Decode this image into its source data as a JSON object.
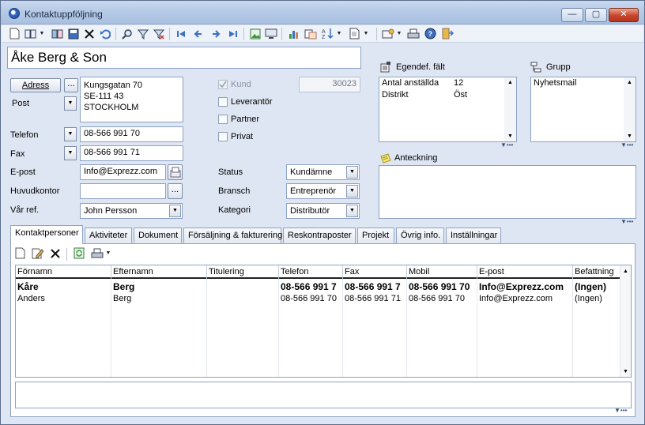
{
  "window": {
    "title": "Kontaktuppföljning",
    "controls": {
      "minimize": "—",
      "maximize": "▢",
      "close": "✕"
    }
  },
  "toolbar": {
    "icons": [
      "new-icon",
      "open-book-icon",
      "books-icon",
      "save-icon",
      "delete-icon",
      "undo-icon",
      "search-icon",
      "filter-icon",
      "clear-filter-icon",
      "first-record-icon",
      "previous-record-icon",
      "next-record-icon",
      "last-record-icon",
      "picture-icon",
      "monitor-icon",
      "chart-icon",
      "report-icon",
      "sort-icon",
      "document-icon",
      "settings-icon",
      "print-icon",
      "help-icon",
      "exit-icon"
    ]
  },
  "company": {
    "name": "Åke Berg & Son"
  },
  "address": {
    "button_label": "Adress",
    "more_label": "...",
    "type_label": "Post",
    "lines": "Kungsgatan 70\nSE-111 43 STOCKHOLM"
  },
  "contact_fields": {
    "phone_label": "Telefon",
    "phone_value": "08-566 991 70",
    "fax_label": "Fax",
    "fax_value": "08-566 991 71",
    "email_label": "E-post",
    "email_value": "Info@Exprezz.com",
    "head_office_label": "Huvudkontor",
    "head_office_value": "",
    "head_office_more": "...",
    "our_ref_label": "Vår ref.",
    "our_ref_value": "John Persson"
  },
  "flags": {
    "kund_label": "Kund",
    "kund_checked": true,
    "kund_number": "30023",
    "leverantor_label": "Leverantör",
    "partner_label": "Partner",
    "privat_label": "Privat"
  },
  "classification": {
    "status_label": "Status",
    "status_value": "Kundämne",
    "bransch_label": "Bransch",
    "bransch_value": "Entreprenör",
    "kategori_label": "Kategori",
    "kategori_value": "Distributör"
  },
  "custom_fields": {
    "title": "Egendef. fält",
    "rows": [
      {
        "name": "Antal anställda",
        "value": "12"
      },
      {
        "name": "Distrikt",
        "value": "Öst"
      }
    ]
  },
  "group": {
    "title": "Grupp",
    "items": [
      "Nyhetsmail"
    ]
  },
  "note": {
    "title": "Anteckning",
    "text": ""
  },
  "tabs": [
    "Kontaktpersoner",
    "Aktiviteter",
    "Dokument",
    "Försäljning & fakturering",
    "Reskontraposter",
    "Projekt",
    "Övrig info.",
    "Inställningar"
  ],
  "contacts": {
    "columns": [
      "Förnamn",
      "Efternamn",
      "Titulering",
      "Telefon",
      "Fax",
      "Mobil",
      "E-post",
      "Befattning"
    ],
    "rows": [
      {
        "fornamn": "Kåre",
        "efternamn": "Berg",
        "titulering": "",
        "telefon": "08-566 991 7",
        "fax": "08-566 991 7",
        "mobil": "08-566 991 70",
        "epost": "Info@Exprezz.com",
        "befattning": "(Ingen)",
        "bold": true
      },
      {
        "fornamn": "Anders",
        "efternamn": "Berg",
        "titulering": "",
        "telefon": "08-566 991 70",
        "fax": "08-566 991 71",
        "mobil": "08-566 991 70",
        "epost": "Info@Exprezz.com",
        "befattning": "(Ingen)",
        "bold": false
      }
    ]
  },
  "colors": {
    "window_bg": "#dfe6f3",
    "title_gradient": "#b4c9e6",
    "accent": "#3a6fc4",
    "close_red": "#c8432b"
  }
}
